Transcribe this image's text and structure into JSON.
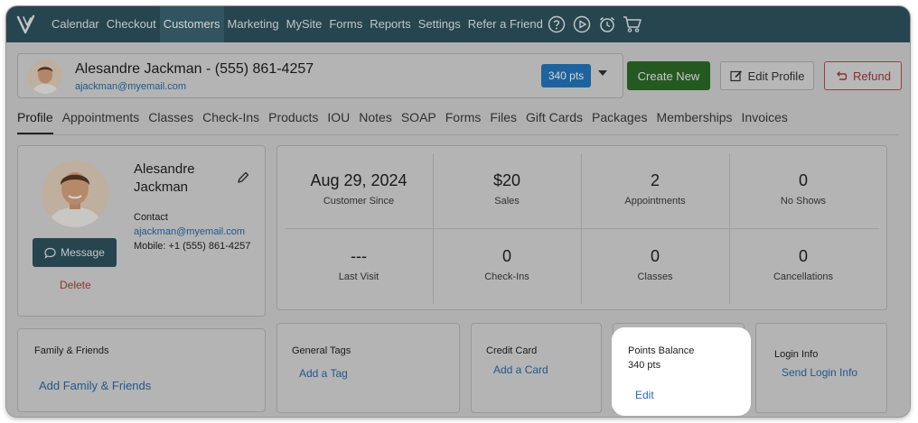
{
  "nav": {
    "items": [
      "Calendar",
      "Checkout",
      "Customers",
      "Marketing",
      "MySite",
      "Forms",
      "Reports",
      "Settings",
      "Refer a Friend"
    ],
    "active": "Customers",
    "icons": [
      "help-icon",
      "play-icon",
      "alarm-clock-icon",
      "cart-icon"
    ]
  },
  "customer": {
    "header_name": "Alesandre Jackman - (555) 861-4257",
    "email": "ajackman@myemail.com",
    "points_badge": "340 pts"
  },
  "actions": {
    "create_new": "Create New",
    "edit_profile": "Edit Profile",
    "refund": "Refund"
  },
  "tabs": [
    "Profile",
    "Appointments",
    "Classes",
    "Check-Ins",
    "Products",
    "IOU",
    "Notes",
    "SOAP",
    "Forms",
    "Files",
    "Gift Cards",
    "Packages",
    "Memberships",
    "Invoices"
  ],
  "profile": {
    "first_name": "Alesandre",
    "last_name": "Jackman",
    "contact_label": "Contact",
    "email": "ajackman@myemail.com",
    "mobile": "Mobile: +1 (555) 861-4257",
    "message_button": "Message",
    "delete_link": "Delete"
  },
  "stats": [
    {
      "value": "Aug 29, 2024",
      "label": "Customer Since"
    },
    {
      "value": "$20",
      "label": "Sales"
    },
    {
      "value": "2",
      "label": "Appointments"
    },
    {
      "value": "0",
      "label": "No Shows"
    },
    {
      "value": "---",
      "label": "Last Visit"
    },
    {
      "value": "0",
      "label": "Check-Ins"
    },
    {
      "value": "0",
      "label": "Classes"
    },
    {
      "value": "0",
      "label": "Cancellations"
    }
  ],
  "cards": {
    "family": {
      "title": "Family & Friends",
      "link": "Add Family & Friends"
    },
    "tags": {
      "title": "General Tags",
      "link": "Add a Tag"
    },
    "credit_card": {
      "title": "Credit Card",
      "link": "Add a Card"
    },
    "points": {
      "title": "Points Balance",
      "value": "340 pts",
      "link": "Edit"
    },
    "login": {
      "title": "Login Info",
      "link": "Send Login Info"
    }
  },
  "colors": {
    "nav_bg": "#2e5360",
    "primary_btn": "#2d6b2a",
    "points_badge": "#2577bd",
    "link": "#2a6aa8",
    "danger": "#b03a3a"
  }
}
